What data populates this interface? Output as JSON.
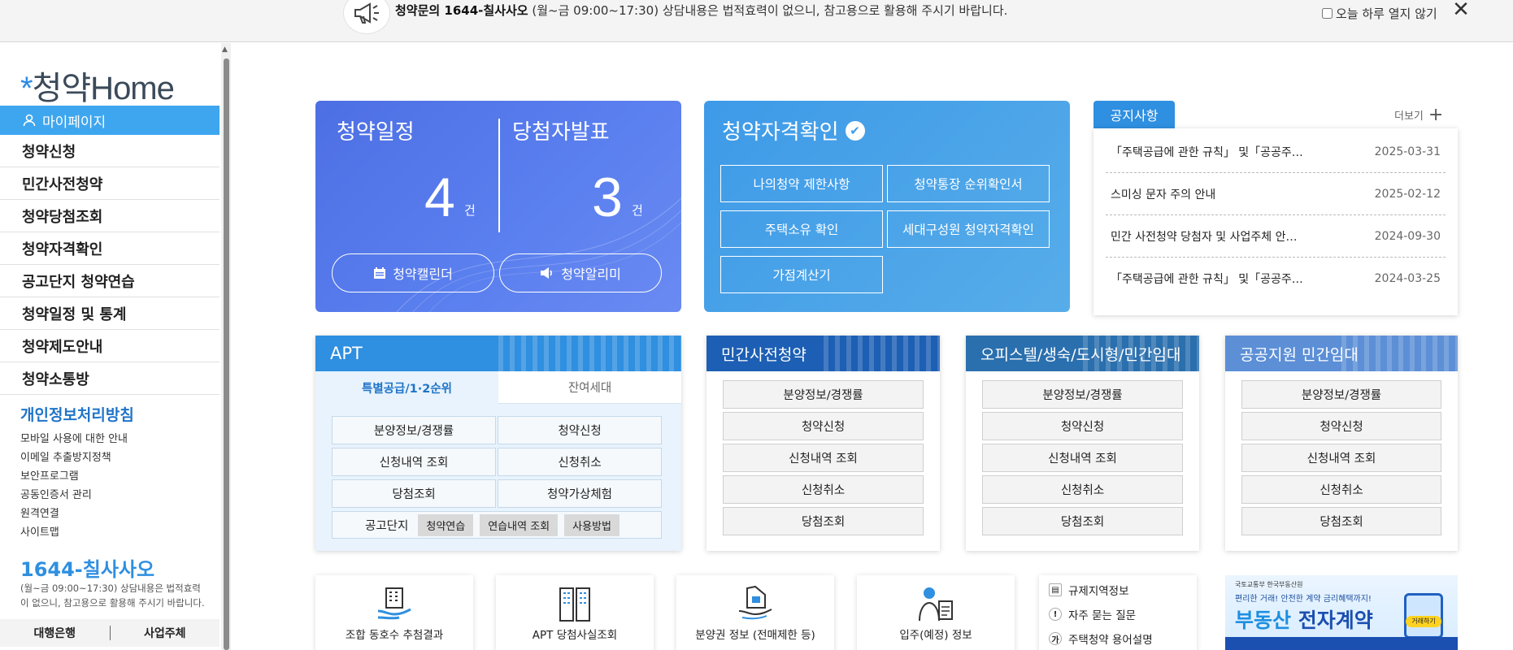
{
  "top_banner": {
    "call_title": "청약문의 1644-칠사사오",
    "hours": "(월~금 09:00~17:30)",
    "notice_text": "상담내용은 법적효력이 없으니, 참고용으로 활용해 주시기 바랍니다.",
    "dont_show_today": "오늘 하루 열지 않기",
    "close_label": "✕"
  },
  "sidebar": {
    "logo_star": "*",
    "logo_text": "청약Home",
    "mypage": "마이페이지",
    "items": [
      "청약신청",
      "민간사전청약",
      "청약당첨조회",
      "청약자격확인",
      "공고단지 청약연습",
      "청약일정 및 통계",
      "청약제도안내",
      "청약소통방"
    ],
    "privacy_title": "개인정보처리방침",
    "sub_links": [
      "모바일 사용에 대한 안내",
      "이메일 추출방지정책",
      "보안프로그램",
      "공동인증서 관리",
      "원격연결",
      "사이트맵"
    ],
    "call_number": "1644-칠사사오",
    "call_hours": "(월~금 09:00~17:30) 상담내용은 법적효력이 없으니, 참고용으로 활용해 주시기 바랍니다.",
    "bottom_tabs": [
      "대행은행",
      "사업주체"
    ]
  },
  "schedule_card": {
    "title_left": "청약일정",
    "title_right": "당첨자발표",
    "count_left": "4",
    "count_right": "3",
    "unit": "건",
    "btn_calendar": "청약캘린더",
    "btn_alarm": "청약알리미"
  },
  "qual_card": {
    "title": "청약자격확인",
    "check": "✔",
    "buttons": [
      "나의청약 제한사항",
      "청약통장 순위확인서",
      "주택소유 확인",
      "세대구성원 청약자격확인",
      "가점계산기"
    ]
  },
  "notice_card": {
    "tab": "공지사항",
    "more": "더보기",
    "more_icon": "+",
    "rows": [
      {
        "title": "「주택공급에 관한 규칙」 및「공공주…",
        "date": "2025-03-31"
      },
      {
        "title": "스미싱 문자 주의 안내",
        "date": "2025-02-12"
      },
      {
        "title": "민간 사전청약 당첨자 및 사업주체 안…",
        "date": "2024-09-30"
      },
      {
        "title": "「주택공급에 관한 규칙」 및「공공주…",
        "date": "2024-03-25"
      }
    ]
  },
  "apt_panel": {
    "title": "APT",
    "tab_active": "특별공급/1·2순위",
    "tab_inactive": "잔여세대",
    "buttons": [
      "분양정보/경쟁률",
      "청약신청",
      "신청내역 조회",
      "신청취소",
      "당첨조회",
      "청약가상체험"
    ],
    "row4_label": "공고단지",
    "chips": [
      "청약연습",
      "연습내역 조회",
      "사용방법"
    ]
  },
  "panels": [
    {
      "title": "민간사전청약",
      "buttons": [
        "분양정보/경쟁률",
        "청약신청",
        "신청내역 조회",
        "신청취소",
        "당첨조회"
      ]
    },
    {
      "title": "오피스텔/생숙/도시형/민간임대",
      "buttons": [
        "분양정보/경쟁률",
        "청약신청",
        "신청내역 조회",
        "신청취소",
        "당첨조회"
      ]
    },
    {
      "title": "공공지원 민간임대",
      "buttons": [
        "분양정보/경쟁률",
        "청약신청",
        "신청내역 조회",
        "신청취소",
        "당첨조회"
      ]
    }
  ],
  "icon_cards": [
    {
      "label": "조합 동호수 추첨결과",
      "icon": "building-hand-icon"
    },
    {
      "label": "APT 당첨사실조회",
      "icon": "apartment-icon"
    },
    {
      "label": "분양권 정보 (전매제한 등)",
      "icon": "house-document-icon"
    },
    {
      "label": "입주(예정) 정보",
      "icon": "person-document-icon"
    }
  ],
  "link_card": [
    {
      "label": "규제지역정보",
      "icon": "document-icon",
      "glyph": "▤"
    },
    {
      "label": "자주 묻는 질문",
      "icon": "exclamation-icon",
      "glyph": "!"
    },
    {
      "label": "주택청약 용어설명",
      "icon": "ga-icon",
      "glyph": "가"
    }
  ],
  "banner": {
    "small_text": "국토교통부  한국부동산원",
    "sub_text": "편리한 거래! 안전한 계약 금리혜택까지!",
    "headline_1": "부동산 ",
    "headline_2": "전자계약",
    "pill": "거래하기"
  },
  "colors": {
    "primary_blue": "#2f8fe0",
    "sidebar_highlight": "#3ea6ef",
    "schedule_card": "#4d6fe4",
    "qual_card": "#3e9ae8",
    "minganpre_head": "#1d5fb4",
    "officetel_head": "#2a6fae",
    "public_rent_head": "#5c8fd6"
  }
}
